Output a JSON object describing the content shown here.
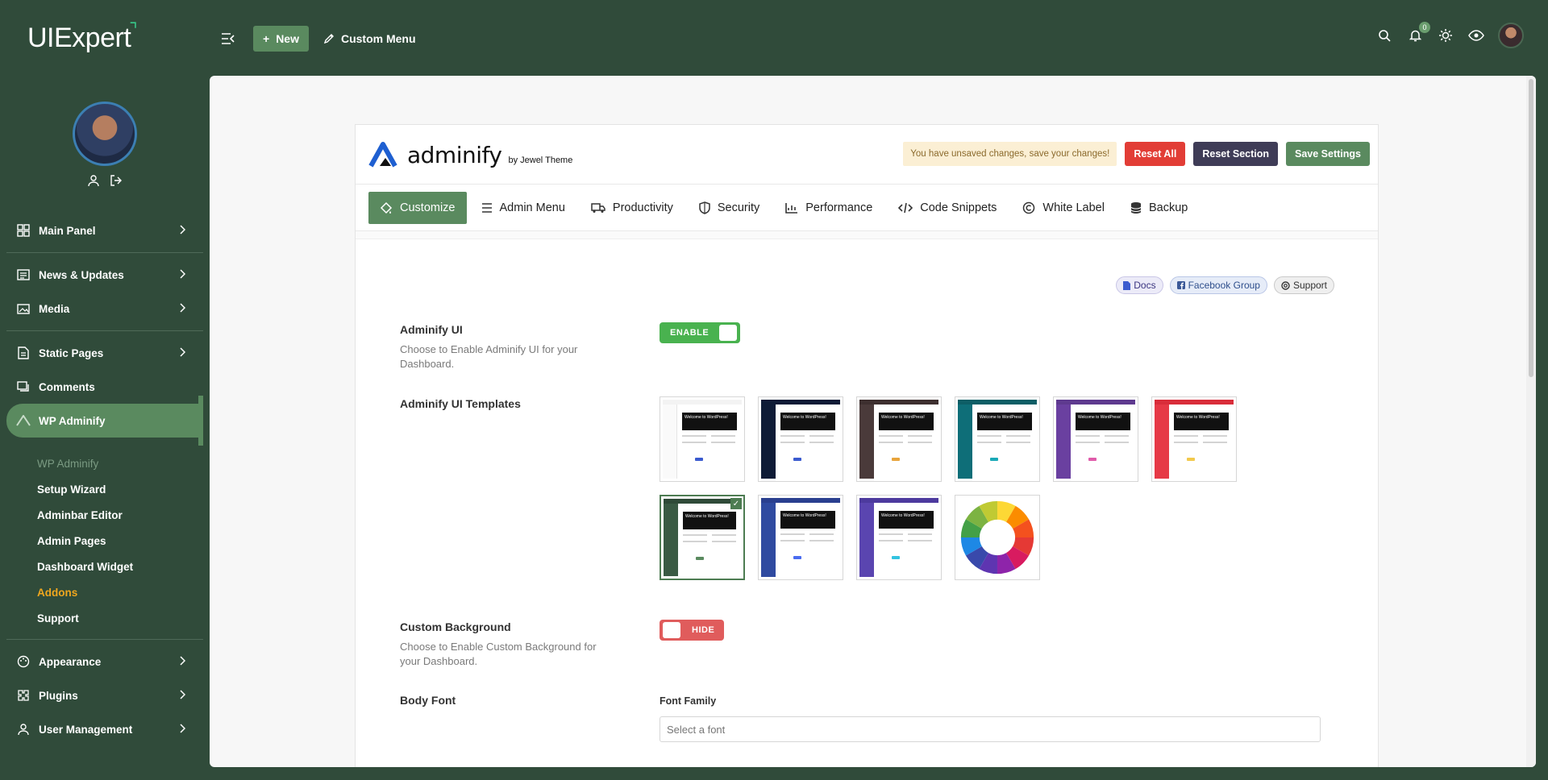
{
  "app": {
    "logo": "UIExpert"
  },
  "topbar": {
    "new_label": "New",
    "custom_menu_label": "Custom Menu",
    "notification_count": "0"
  },
  "sidebar": {
    "items_top": [
      {
        "label": "Main Panel",
        "icon": "grid-icon"
      },
      {
        "label": "News & Updates",
        "icon": "news-icon"
      },
      {
        "label": "Media",
        "icon": "media-icon"
      }
    ],
    "items_mid": [
      {
        "label": "Static Pages",
        "icon": "page-icon"
      },
      {
        "label": "Comments",
        "icon": "comment-icon"
      },
      {
        "label": "WP Adminify",
        "icon": "adminify-icon"
      }
    ],
    "submenu": [
      "WP Adminify",
      "Setup Wizard",
      "Adminbar Editor",
      "Admin Pages",
      "Dashboard Widget",
      "Addons",
      "Support"
    ],
    "items_bottom": [
      {
        "label": "Appearance",
        "icon": "palette-icon"
      },
      {
        "label": "Plugins",
        "icon": "plugin-icon"
      },
      {
        "label": "User Management",
        "icon": "user-icon"
      }
    ]
  },
  "header": {
    "brand": "adminify",
    "by": "by Jewel Theme",
    "unsaved": "You have unsaved changes, save your changes!",
    "reset_all": "Reset All",
    "reset_section": "Reset Section",
    "save": "Save Settings"
  },
  "tabs": [
    "Customize",
    "Admin Menu",
    "Productivity",
    "Security",
    "Performance",
    "Code Snippets",
    "White Label",
    "Backup"
  ],
  "links": {
    "docs": "Docs",
    "facebook": "Facebook Group",
    "support": "Support"
  },
  "settings": {
    "adminify_ui": {
      "label": "Adminify UI",
      "desc": "Choose to Enable Adminify UI for your Dashboard.",
      "toggle": "ENABLE"
    },
    "templates": {
      "label": "Adminify UI Templates",
      "hero_text": "Welcome to WordPress!"
    },
    "custom_bg": {
      "label": "Custom Background",
      "desc": "Choose to Enable Custom Background for your Dashboard.",
      "toggle": "HIDE"
    },
    "body_font": {
      "label": "Body Font",
      "family_label": "Font Family",
      "placeholder": "Select a font"
    }
  },
  "colors": {
    "sidebar_bg": "#304b3a",
    "accent": "#5a8a5f",
    "danger": "#e23d36"
  }
}
